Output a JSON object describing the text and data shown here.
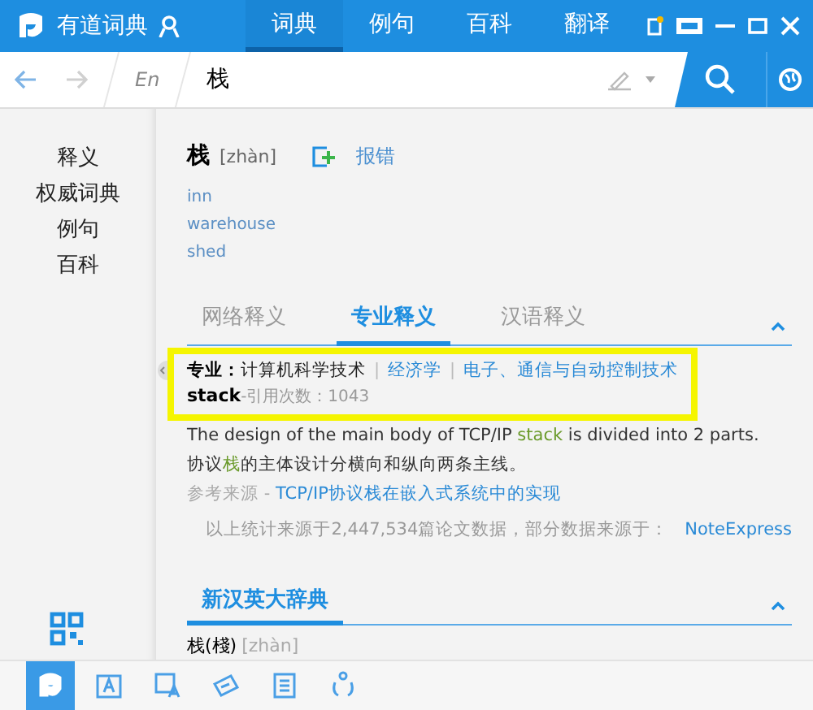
{
  "app": {
    "name": "有道词典"
  },
  "nav_tabs": [
    {
      "label": "词典",
      "selected": true
    },
    {
      "label": "例句",
      "selected": false
    },
    {
      "label": "百科",
      "selected": false
    },
    {
      "label": "翻译",
      "selected": false
    }
  ],
  "search": {
    "lang": "En",
    "value": "栈"
  },
  "side_nav": [
    "释义",
    "权威词典",
    "例句",
    "百科"
  ],
  "entry": {
    "word": "栈",
    "pinyin": "[zhàn]",
    "report": "报错",
    "meanings": [
      "inn",
      "warehouse",
      "shed"
    ]
  },
  "def_tabs": [
    {
      "label": "网络释义",
      "selected": false
    },
    {
      "label": "专业释义",
      "selected": true
    },
    {
      "label": "汉语释义",
      "selected": false
    }
  ],
  "pro": {
    "label": "专业：",
    "fields": [
      {
        "text": "计算机科学技术",
        "selected": true
      },
      {
        "divider": "|",
        "text": "经济学",
        "selected": false
      },
      {
        "divider": "|",
        "text": "电子、通信与自动控制技术",
        "selected": false
      }
    ],
    "term": "stack",
    "count": "-引用次数：1043",
    "examples": [
      [
        {
          "text": "The design of the main body of TCP/IP ",
          "highlight": false
        },
        {
          "text": "stack",
          "highlight": true
        },
        {
          "text": " is divided into 2 parts.",
          "highlight": false
        }
      ],
      [
        {
          "text": "协议",
          "highlight": false
        },
        {
          "text": "栈",
          "highlight": true
        },
        {
          "text": "的主体设计分横向和纵向两条主线。",
          "highlight": false
        }
      ]
    ],
    "source_label": "参考来源 - ",
    "source_link": "TCP/IP协议栈在嵌入式系统中的实现",
    "stats": "以上统计来源于2,447,534篇论文数据，部分数据来源于：",
    "stats_link": "NoteExpress"
  },
  "section": {
    "title": "新汉英大辞典",
    "word": "栈(棧)",
    "pinyin": "[zhàn]"
  },
  "toolbar": [
    {
      "kind": "dict",
      "selected": true
    },
    {
      "kind": "word",
      "selected": false
    },
    {
      "kind": "image",
      "selected": false
    },
    {
      "kind": "tag",
      "selected": false
    },
    {
      "kind": "translate",
      "selected": false
    },
    {
      "kind": "network",
      "selected": false
    }
  ]
}
